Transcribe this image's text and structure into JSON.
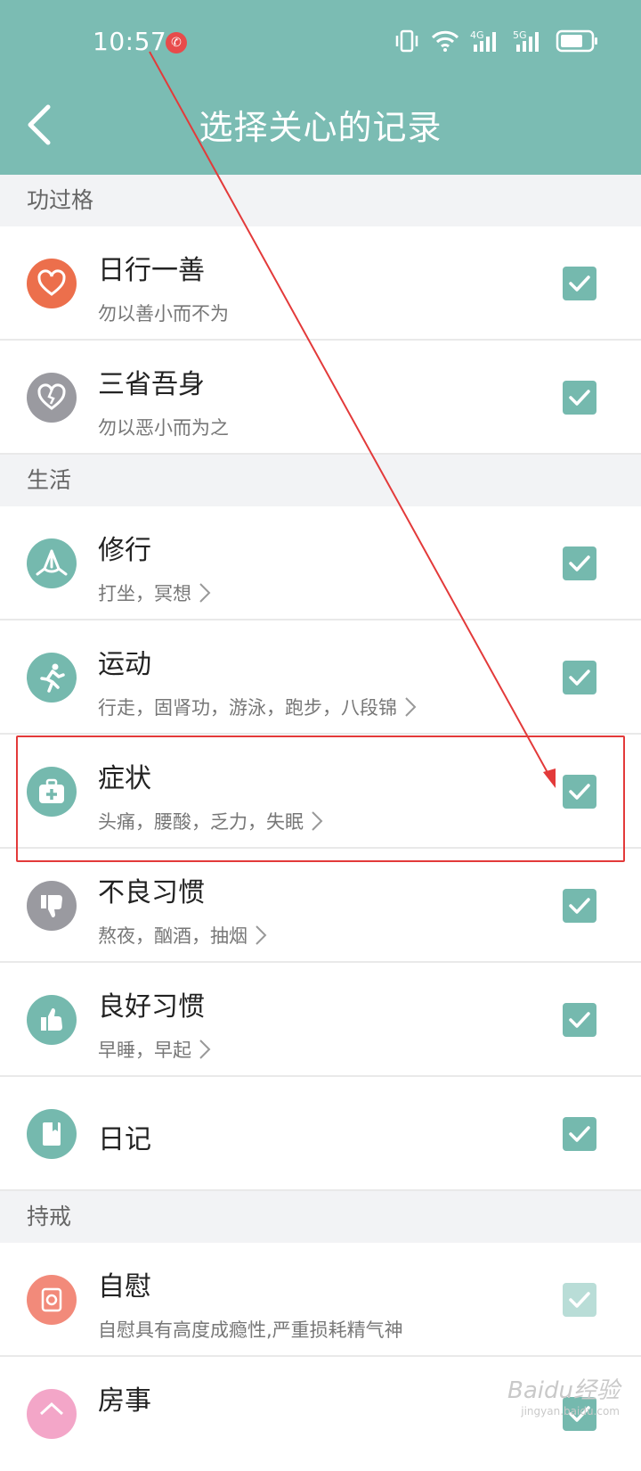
{
  "status_bar": {
    "time": "10:57",
    "alert_glyph": "✆"
  },
  "header": {
    "title": "选择关心的记录"
  },
  "sections": [
    {
      "label": "功过格",
      "items": [
        {
          "title": "日行一善",
          "subtitle": "勿以善小而不为",
          "icon": "heart-icon",
          "icon_color": "#ec6f4c",
          "checked": true,
          "has_arrow": false
        },
        {
          "title": "三省吾身",
          "subtitle": "勿以恶小而为之",
          "icon": "broken-heart-icon",
          "icon_color": "#9a9aa0",
          "checked": true,
          "has_arrow": false
        }
      ]
    },
    {
      "label": "生活",
      "items": [
        {
          "title": "修行",
          "subtitle": "打坐，冥想",
          "icon": "meditation-icon",
          "icon_color": "#75b9ae",
          "checked": true,
          "has_arrow": true
        },
        {
          "title": "运动",
          "subtitle": "行走，固肾功，游泳，跑步，八段锦",
          "icon": "running-icon",
          "icon_color": "#75b9ae",
          "checked": true,
          "has_arrow": true
        },
        {
          "title": "症状",
          "subtitle": "头痛，腰酸，乏力，失眠",
          "icon": "medical-kit-icon",
          "icon_color": "#75b9ae",
          "checked": true,
          "has_arrow": true
        },
        {
          "title": "不良习惯",
          "subtitle": "熬夜，酗酒，抽烟",
          "icon": "thumbs-down-icon",
          "icon_color": "#9a9aa0",
          "checked": true,
          "has_arrow": true
        },
        {
          "title": "良好习惯",
          "subtitle": "早睡，早起",
          "icon": "thumbs-up-icon",
          "icon_color": "#75b9ae",
          "checked": true,
          "has_arrow": true
        },
        {
          "title": "日记",
          "subtitle": "",
          "icon": "diary-icon",
          "icon_color": "#75b9ae",
          "checked": true,
          "has_arrow": false
        }
      ]
    },
    {
      "label": "持戒",
      "items": [
        {
          "title": "自慰",
          "subtitle": "自慰具有高度成瘾性,严重损耗精气神",
          "icon": "tissue-roll-icon",
          "icon_color": "#f28a7a",
          "checked": true,
          "dim": true,
          "has_arrow": false
        },
        {
          "title": "房事",
          "subtitle": "",
          "icon": "house-icon",
          "icon_color": "#f3a6c8",
          "checked": true,
          "has_arrow": false
        }
      ]
    }
  ],
  "watermark": {
    "main": "Baidu经验",
    "sub": "jingyan.baidu.com"
  },
  "colors": {
    "accent": "#7bbcb3",
    "annotation": "#e33a3a"
  }
}
